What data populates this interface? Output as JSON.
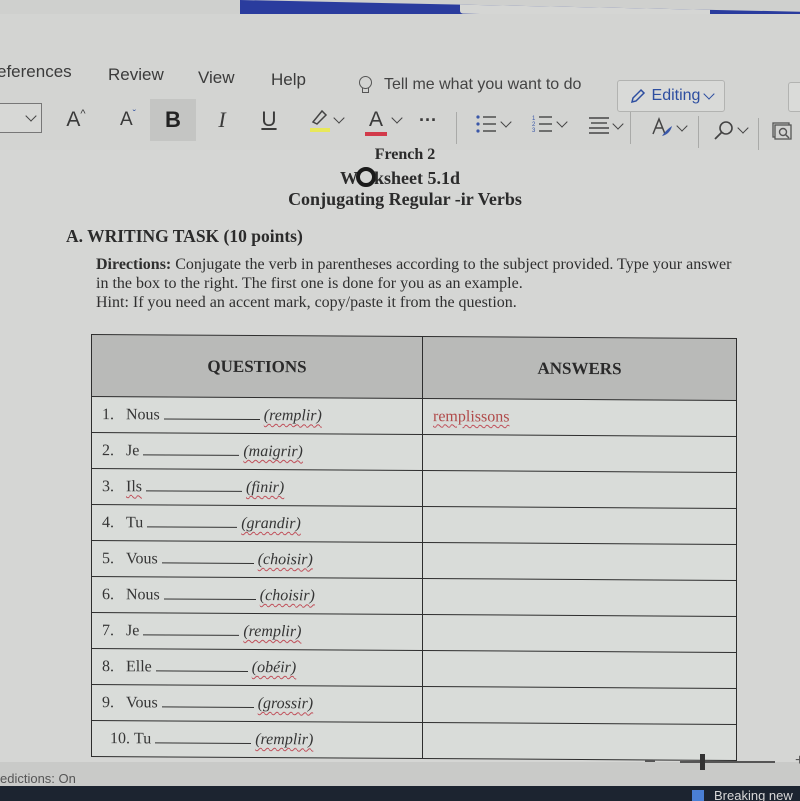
{
  "ribbon": {
    "tabs": [
      "eferences",
      "Review",
      "View",
      "Help"
    ],
    "tell_me": "Tell me what you want to do",
    "editing_label": "Editing",
    "toolbar": {
      "grow_font": "A",
      "shrink_font": "A",
      "bold": "B",
      "italic": "I",
      "underline": "U",
      "font_color": "A",
      "more": "···"
    },
    "colors": {
      "highlight": "#e8e85a",
      "font_color_bar": "#d23a4a",
      "accent": "#2d4ea0"
    }
  },
  "document": {
    "title_lines": [
      "French 2",
      "ksheet 5.1d",
      "Conjugating Regular -ir Verbs"
    ],
    "title_prefix": "W",
    "section_heading": "A.  WRITING TASK (10 points)",
    "directions_label": "Directions:",
    "directions_text": " Conjugate the verb in parentheses according to the subject provided. Type your answer in the box to the right. The first one is done for you as an example.",
    "hint": "Hint: If you need an accent mark, copy/paste it from the question.",
    "table": {
      "headers": [
        "QUESTIONS",
        "ANSWERS"
      ],
      "rows": [
        {
          "num": "1.",
          "subject": "Nous",
          "verb": "(remplir)",
          "answer": "remplissons"
        },
        {
          "num": "2.",
          "subject": "Je",
          "verb": "(maigrir)",
          "answer": ""
        },
        {
          "num": "3.",
          "subject": "Ils",
          "verb": "(finir)",
          "answer": ""
        },
        {
          "num": "4.",
          "subject": "Tu",
          "verb": "(grandir)",
          "answer": ""
        },
        {
          "num": "5.",
          "subject": "Vous",
          "verb": "(choisir)",
          "answer": ""
        },
        {
          "num": "6.",
          "subject": "Nous",
          "verb": "(choisir)",
          "answer": ""
        },
        {
          "num": "7.",
          "subject": "Je",
          "verb": "(remplir)",
          "answer": ""
        },
        {
          "num": "8.",
          "subject": "Elle",
          "verb": "(obéir)",
          "answer": ""
        },
        {
          "num": "9.",
          "subject": "Vous",
          "verb": "(grossir)",
          "answer": ""
        },
        {
          "num": "10.",
          "subject": "Tu",
          "verb": "(remplir)",
          "answer": ""
        }
      ]
    }
  },
  "status_bar": {
    "predictions": "edictions: On",
    "zoom_minus": "-",
    "zoom_plus": "+"
  },
  "taskbar": {
    "news_label": "Breaking new"
  }
}
